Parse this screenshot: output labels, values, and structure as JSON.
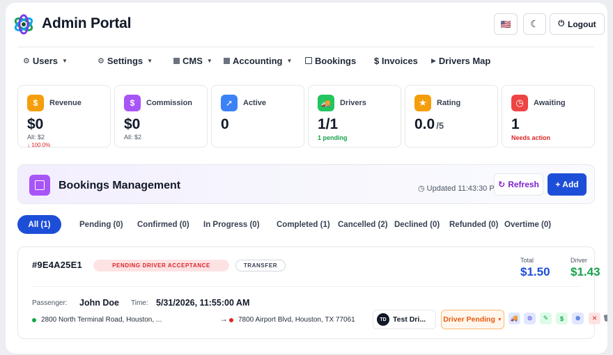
{
  "header": {
    "title": "Admin Portal",
    "language_flag": "🇺🇸",
    "theme_icon": "☾",
    "logout_label": "Logout"
  },
  "nav": [
    {
      "label": "Users",
      "icon": "gear-icon",
      "dropdown": true
    },
    {
      "label": "Settings",
      "icon": "gear-icon",
      "dropdown": true
    },
    {
      "label": "CMS",
      "icon": "square-icon",
      "dropdown": true
    },
    {
      "label": "Accounting",
      "icon": "square-icon",
      "dropdown": true
    },
    {
      "label": "Bookings",
      "icon": "box-icon",
      "dropdown": false
    },
    {
      "label": "$ Invoices",
      "icon": "none",
      "dropdown": false
    },
    {
      "label": "Drivers Map",
      "icon": "play-icon",
      "dropdown": false
    }
  ],
  "stats": [
    {
      "label": "Revenue",
      "value": "$0",
      "sub": "All: $2",
      "sub2": "↓ 100.0%",
      "icon": "dollar-icon",
      "glyph": "$",
      "color": "#f59e0b"
    },
    {
      "label": "Commission",
      "value": "$0",
      "sub": "All: $2",
      "icon": "dollar-icon",
      "glyph": "$",
      "color": "#a855f7"
    },
    {
      "label": "Active",
      "value": "0",
      "icon": "arrow-up-icon",
      "glyph": "➚",
      "color": "#3b82f6"
    },
    {
      "label": "Drivers",
      "value": "1/1",
      "note": "1 pending",
      "note_color": "#16a34a",
      "icon": "truck-icon",
      "glyph": "🚚",
      "color": "#22c55e"
    },
    {
      "label": "Rating",
      "value": "0.0",
      "suffix": "/5",
      "icon": "star-icon",
      "glyph": "★",
      "color": "#f59e0b"
    },
    {
      "label": "Awaiting",
      "value": "1",
      "note": "Needs action",
      "note_color": "#dc2626",
      "icon": "clock-icon",
      "glyph": "◷",
      "color": "#ef4444"
    }
  ],
  "banner": {
    "title": "Bookings Management",
    "updated": "Updated 11:43:30 P",
    "refresh_label": "Refresh",
    "add_label": "+ Add"
  },
  "tabs": [
    {
      "label": "All (1)",
      "active": true
    },
    {
      "label": "Pending (0)"
    },
    {
      "label": "Confirmed (0)"
    },
    {
      "label": "In Progress (0)"
    },
    {
      "label": "Completed (1)"
    },
    {
      "label": "Cancelled (2)"
    },
    {
      "label": "Declined (0)"
    },
    {
      "label": "Refunded (0)"
    },
    {
      "label": "Overtime (0)"
    }
  ],
  "booking": {
    "id": "#9E4A25E1",
    "status": "PENDING DRIVER ACCEPTANCE",
    "type": "TRANSFER",
    "total_label": "Total",
    "total": "$1.50",
    "driver_label": "Driver",
    "driver_amount": "$1.43",
    "passenger_label": "Passenger:",
    "passenger": "John Doe",
    "time_label": "Time:",
    "time": "5/31/2026, 11:55:00 AM",
    "pickup": "2800 North Terminal Road, Houston, ...",
    "dropoff": "7800 Airport Blvd, Houston, TX 77061",
    "driver_initials": "TD",
    "driver_name": "Test Dri...",
    "driver_status": "Driver Pending",
    "actions": [
      {
        "name": "truck-action-icon",
        "glyph": "🚚",
        "bg": "#e0e7ff",
        "color": "#1d4ed8"
      },
      {
        "name": "view-action-icon",
        "glyph": "⊙",
        "bg": "#e0e7ff",
        "color": "#4f46e5"
      },
      {
        "name": "edit-action-icon",
        "glyph": "✎",
        "bg": "#dcfce7",
        "color": "#16a34a"
      },
      {
        "name": "payment-action-icon",
        "glyph": "$",
        "bg": "#dcfce7",
        "color": "#16a34a"
      },
      {
        "name": "assign-action-icon",
        "glyph": "⊕",
        "bg": "#e0e7ff",
        "color": "#1d4ed8"
      },
      {
        "name": "cancel-action-icon",
        "glyph": "✕",
        "bg": "#fee2e2",
        "color": "#dc2626"
      },
      {
        "name": "trash-action-icon",
        "glyph": "🗑",
        "bg": "transparent",
        "color": "#6b7280"
      }
    ]
  },
  "colors": {
    "primary": "#1d4ed8",
    "purple": "#7e22ce",
    "green": "#16a34a",
    "danger": "#dc2626"
  }
}
